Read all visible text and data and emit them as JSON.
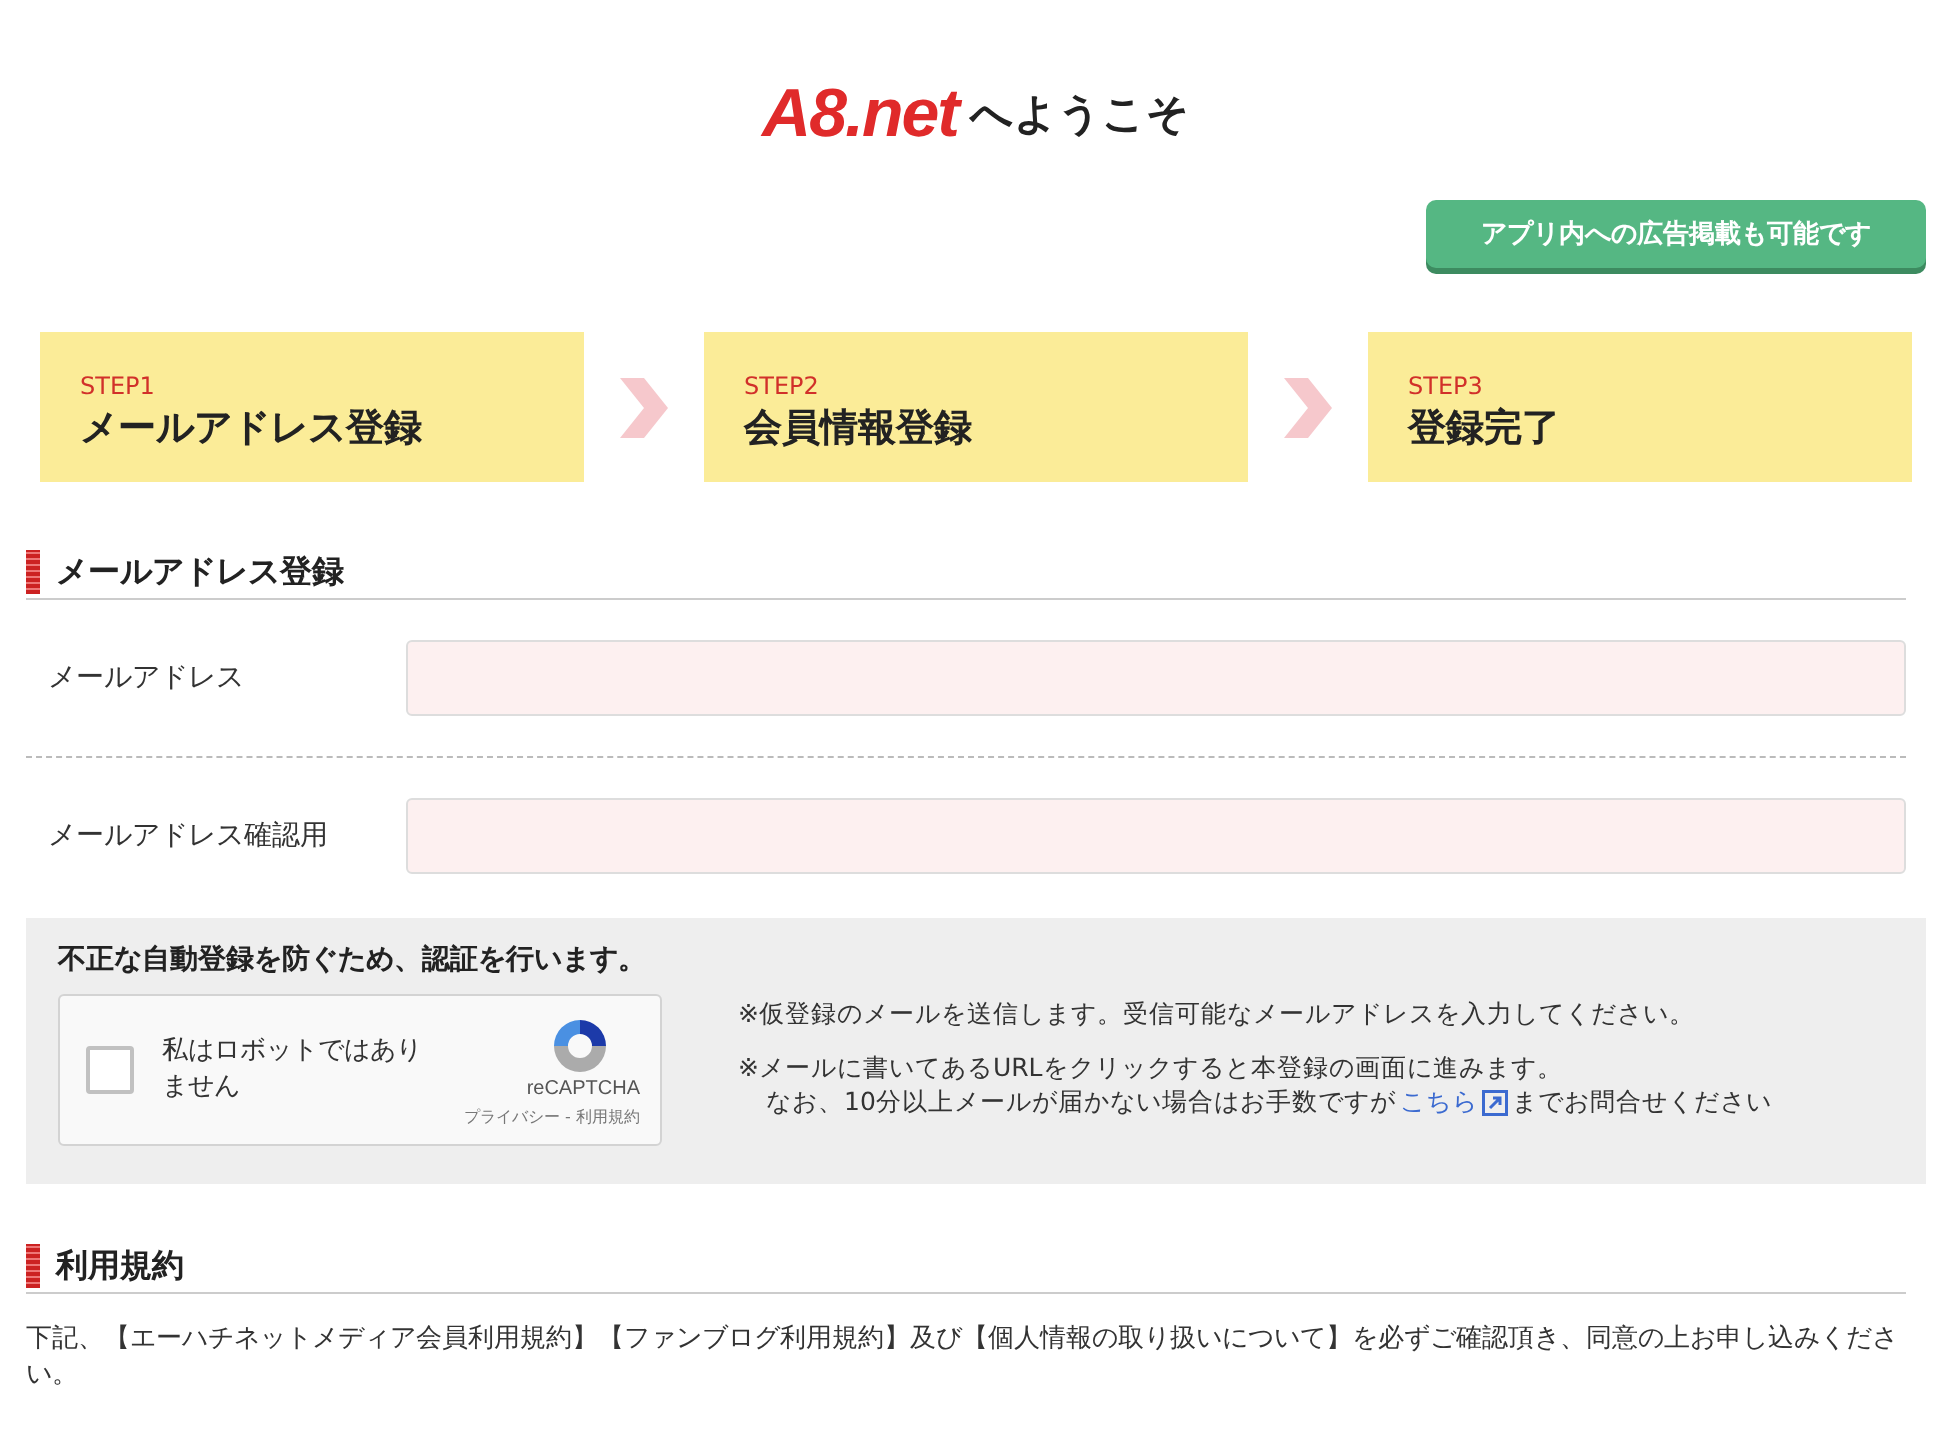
{
  "header": {
    "logo": "A8.net",
    "title": "へようこそ"
  },
  "promo_button": "アプリ内への広告掲載も可能です",
  "steps": [
    {
      "label": "STEP1",
      "title": "メールアドレス登録"
    },
    {
      "label": "STEP2",
      "title": "会員情報登録"
    },
    {
      "label": "STEP3",
      "title": "登録完了"
    }
  ],
  "email_section": {
    "heading": "メールアドレス登録",
    "fields": [
      {
        "label": "メールアドレス"
      },
      {
        "label": "メールアドレス確認用"
      }
    ]
  },
  "verification": {
    "heading": "不正な自動登録を防ぐため、認証を行います。",
    "captcha": {
      "label": "私はロボットではありません",
      "checked": false,
      "brand": "reCAPTCHA",
      "links": "プライバシー - 利用規約"
    },
    "notes": [
      "※仮登録のメールを送信します。受信可能なメールアドレスを入力してください。",
      "※メールに書いてあるURLをクリックすると本登録の画面に進みます。"
    ],
    "note_tail": {
      "before": "なお、10分以上メールが届かない場合はお手数ですが",
      "link": "こちら",
      "after": "までお問合せください"
    }
  },
  "terms_section": {
    "heading": "利用規約",
    "text": "下記、【エーハチネットメディア会員利用規約】【ファンブログ利用規約】及び【個人情報の取り扱いについて】を必ずご確認頂き、同意の上お申し込みください。"
  }
}
